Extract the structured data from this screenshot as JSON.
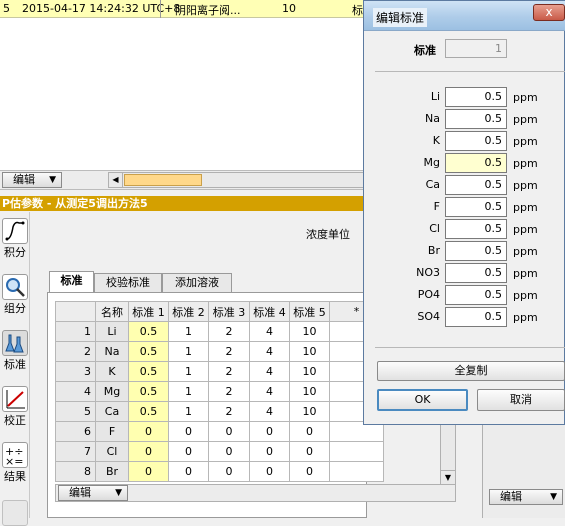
{
  "top_row": {
    "number": "5",
    "timestamp": "2015-04-17 14:24:32 UTC+8",
    "name": "阴阳离子阅...",
    "count": "10",
    "cut": "标"
  },
  "mid_toolbar": {
    "edit_label": "编辑"
  },
  "panel_title": "P估参数 - 从测定5调出方法5",
  "left_toolbar": [
    {
      "label": "积分",
      "icon": "integration-icon"
    },
    {
      "label": "组分",
      "icon": "component-icon"
    },
    {
      "label": "标准",
      "icon": "flask-icon"
    },
    {
      "label": "校正",
      "icon": "calibration-icon"
    },
    {
      "label": "结果",
      "icon": "result-icon"
    }
  ],
  "conc_unit_label": "浓度单位",
  "tabs": [
    "标准",
    "校验标准",
    "添加溶液"
  ],
  "table": {
    "headers": [
      "名称",
      "标准 1",
      "标准 2",
      "标准 3",
      "标准 4",
      "标准 5",
      "*"
    ],
    "rows": [
      {
        "n": "1",
        "name": "Li",
        "v": [
          "0.5",
          "1",
          "2",
          "4",
          "10"
        ]
      },
      {
        "n": "2",
        "name": "Na",
        "v": [
          "0.5",
          "1",
          "2",
          "4",
          "10"
        ]
      },
      {
        "n": "3",
        "name": "K",
        "v": [
          "0.5",
          "1",
          "2",
          "4",
          "10"
        ]
      },
      {
        "n": "4",
        "name": "Mg",
        "v": [
          "0.5",
          "1",
          "2",
          "4",
          "10"
        ]
      },
      {
        "n": "5",
        "name": "Ca",
        "v": [
          "0.5",
          "1",
          "2",
          "4",
          "10"
        ]
      },
      {
        "n": "6",
        "name": "F",
        "v": [
          "0",
          "0",
          "0",
          "0",
          "0"
        ]
      },
      {
        "n": "7",
        "name": "Cl",
        "v": [
          "0",
          "0",
          "0",
          "0",
          "0"
        ]
      },
      {
        "n": "8",
        "name": "Br",
        "v": [
          "0",
          "0",
          "0",
          "0",
          "0"
        ]
      }
    ]
  },
  "table_edit_label": "编辑",
  "right_edit_label": "编辑",
  "dialog": {
    "title": "编辑标准",
    "close": "x",
    "std_label": "标准",
    "std_value": "1",
    "unit": "ppm",
    "elements": [
      {
        "name": "Li",
        "value": "0.5"
      },
      {
        "name": "Na",
        "value": "0.5"
      },
      {
        "name": "K",
        "value": "0.5"
      },
      {
        "name": "Mg",
        "value": "0.5"
      },
      {
        "name": "Ca",
        "value": "0.5"
      },
      {
        "name": "F",
        "value": "0.5"
      },
      {
        "name": "Cl",
        "value": "0.5"
      },
      {
        "name": "Br",
        "value": "0.5"
      },
      {
        "name": "NO3",
        "value": "0.5"
      },
      {
        "name": "PO4",
        "value": "0.5"
      },
      {
        "name": "SO4",
        "value": "0.5"
      }
    ],
    "copy_all": "全复制",
    "ok": "OK",
    "cancel": "取消"
  },
  "colors": {
    "panel_title_bg": "#d4a000",
    "highlight_yellow": "#ffffb0",
    "dialog_title_bg": "#aecce9"
  }
}
